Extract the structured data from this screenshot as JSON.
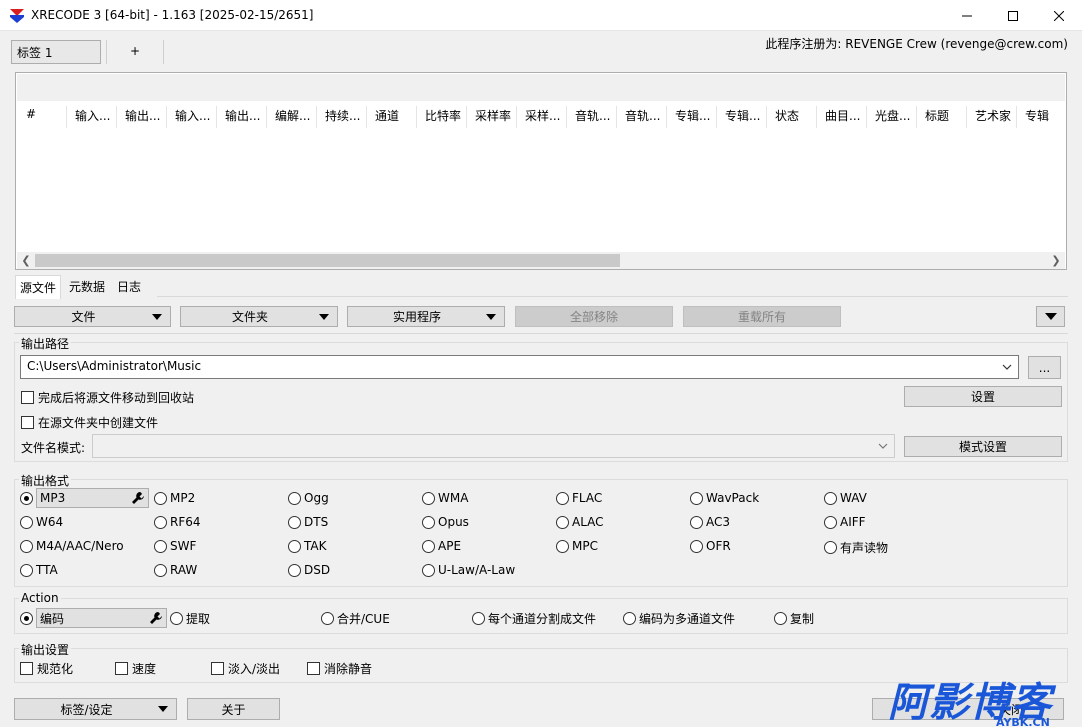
{
  "window": {
    "title": "XRECODE 3 [64-bit] - 1.163 [2025-02-15/2651]",
    "registered": "此程序注册为: REVENGE Crew (revenge@crew.com)"
  },
  "top_tabs": [
    {
      "label": "标签 1"
    },
    {
      "label": "+"
    }
  ],
  "columns": [
    "#",
    "输入...",
    "输出...",
    "输入...",
    "输出...",
    "编解...",
    "持续...",
    "通道",
    "比特率",
    "采样率",
    "采样...",
    "音轨...",
    "音轨...",
    "专辑...",
    "专辑...",
    "状态",
    "曲目...",
    "光盘...",
    "标题",
    "艺术家",
    "专辑"
  ],
  "bottom_tabs": [
    {
      "label": "源文件"
    },
    {
      "label": "元数据"
    },
    {
      "label": "日志"
    }
  ],
  "buttons": {
    "file": "文件",
    "folder": "文件夹",
    "utilities": "实用程序",
    "remove_all": "全部移除",
    "reload_all": "重载所有",
    "settings": "设置",
    "pattern_settings": "模式设置",
    "browse": "...",
    "tags_settings": "标签/设定",
    "about": "关于",
    "close": "关闭"
  },
  "output_path": {
    "label": "输出路径",
    "value": "C:\\Users\\Administrator\\Music",
    "move_to_recycle": "完成后将源文件移动到回收站",
    "create_in_source": "在源文件夹中创建文件",
    "filename_pattern_label": "文件名模式:"
  },
  "output_format": {
    "label": "输出格式",
    "selected": "MP3",
    "options": [
      [
        "MP3",
        "MP2",
        "Ogg",
        "WMA",
        "FLAC",
        "WavPack",
        "WAV"
      ],
      [
        "W64",
        "RF64",
        "DTS",
        "Opus",
        "ALAC",
        "AC3",
        "AIFF"
      ],
      [
        "M4A/AAC/Nero",
        "SWF",
        "TAK",
        "APE",
        "MPC",
        "OFR",
        "有声读物"
      ],
      [
        "TTA",
        "RAW",
        "DSD",
        "U-Law/A-Law"
      ]
    ]
  },
  "action": {
    "label": "Action",
    "options": [
      "编码",
      "提取",
      "合并/CUE",
      "每个通道分割成文件",
      "编码为多通道文件",
      "复制"
    ]
  },
  "output_settings": {
    "label": "输出设置",
    "options": [
      "规范化",
      "速度",
      "淡入/淡出",
      "消除静音"
    ]
  },
  "watermark": {
    "main": "阿影博客",
    "sub": "AYBK.CN"
  }
}
